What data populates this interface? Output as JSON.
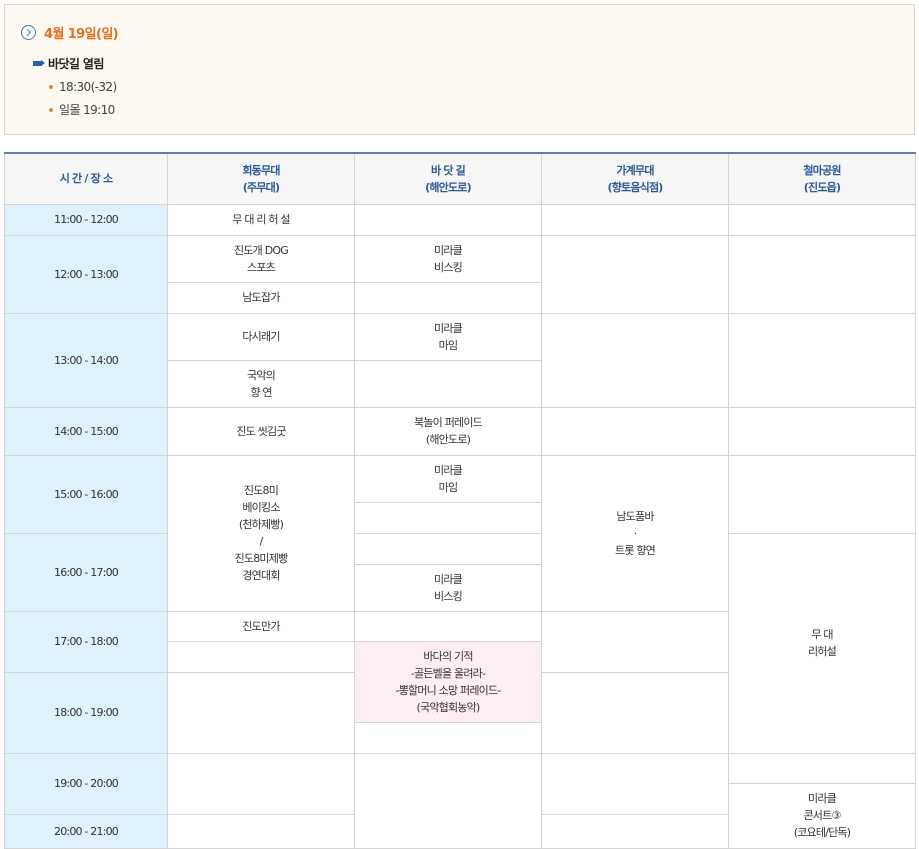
{
  "info": {
    "date": "4월 19일(일)",
    "section_title": "바닷길 열림",
    "bullets": [
      "18:30(-32)",
      "일몰 19:10"
    ]
  },
  "table": {
    "headers": {
      "time": "시 간 / 장 소",
      "c1": "회동무대\n(주무대)",
      "c2": "바 닷 길\n(해안도로)",
      "c3": "가계무대\n(향토음식점)",
      "c4": "철마공원\n(진도읍)"
    },
    "times": [
      "11:00 - 12:00",
      "12:00 - 13:00",
      "13:00 - 14:00",
      "14:00 - 15:00",
      "15:00 - 16:00",
      "16:00 - 17:00",
      "17:00 - 18:00",
      "18:00 - 19:00",
      "19:00 - 20:00",
      "20:00 - 21:00"
    ],
    "c1": {
      "rehearsal": "무 대 리 허 설",
      "dog_sports": "진도개 DOG\n스포츠",
      "namdo_japga": "남도잡가",
      "dasiraegi": "다시래기",
      "gugak": "국악의\n향 연",
      "ssitgimgut": "진도 씻김굿",
      "bakery": "진도8미\n베이킹소\n(천하제빵)\n/\n진도8미제빵\n경연대회",
      "manga": "진도만가"
    },
    "c2": {
      "busking1": "미라클\n비스킹",
      "mime1": "미라클\n마임",
      "buknori": "북놀이 퍼레이드\n(해안도로)",
      "mime2": "미라클\n마임",
      "busking2": "미라클\n비스킹",
      "miracle_sea": "바다의 기적\n-골든벨을 울려라-\n-뽕할머니 소망 퍼레이드-\n(국악협회농악)"
    },
    "c3": {
      "pumba": "남도품바\n·\n트롯 향연"
    },
    "c4": {
      "rehearsal": "무 대\n리허설",
      "concert": "미라클\n콘서트③\n(코요테/단독)"
    }
  }
}
